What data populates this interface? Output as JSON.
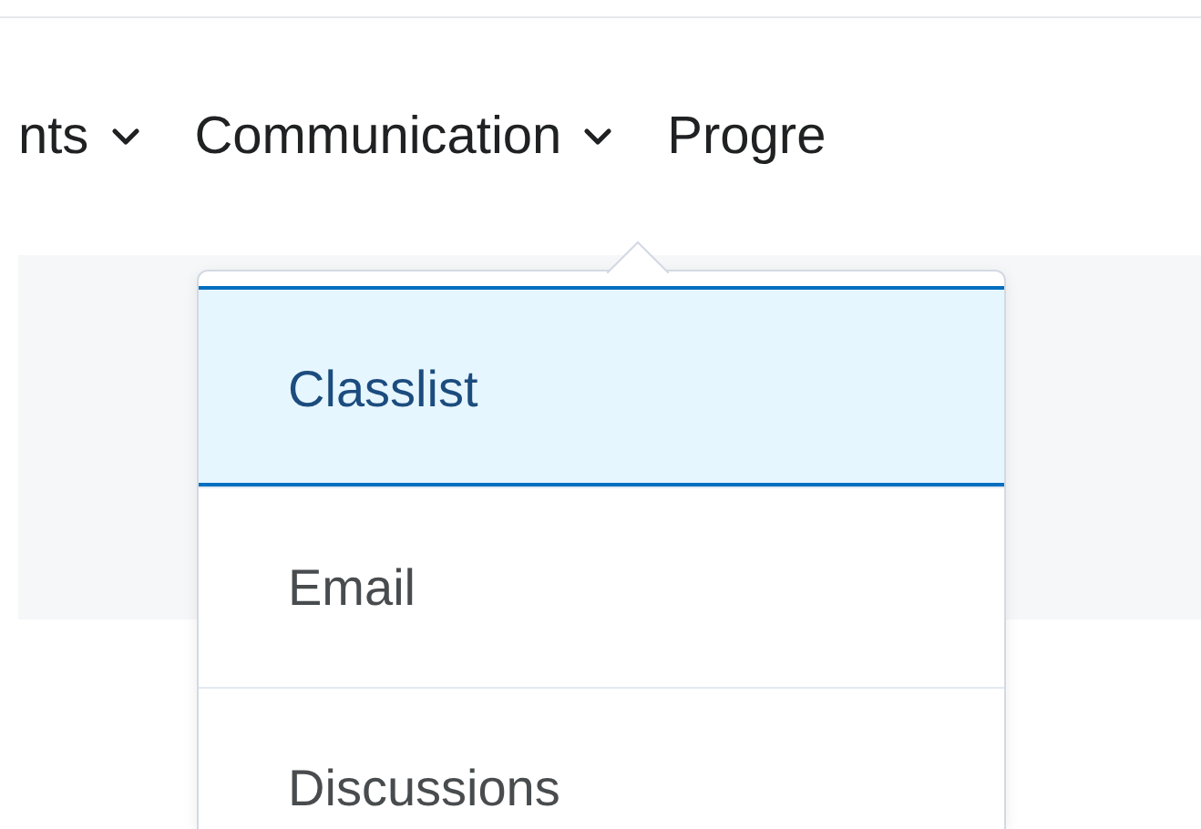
{
  "nav": [
    {
      "label": "nts",
      "dropdown": true
    },
    {
      "label": "Communication",
      "dropdown": true
    },
    {
      "label": "Progre",
      "dropdown": false
    }
  ],
  "menu": [
    {
      "label": "Classlist",
      "selected": true
    },
    {
      "label": "Email",
      "selected": false
    },
    {
      "label": "Discussions",
      "selected": false
    }
  ]
}
